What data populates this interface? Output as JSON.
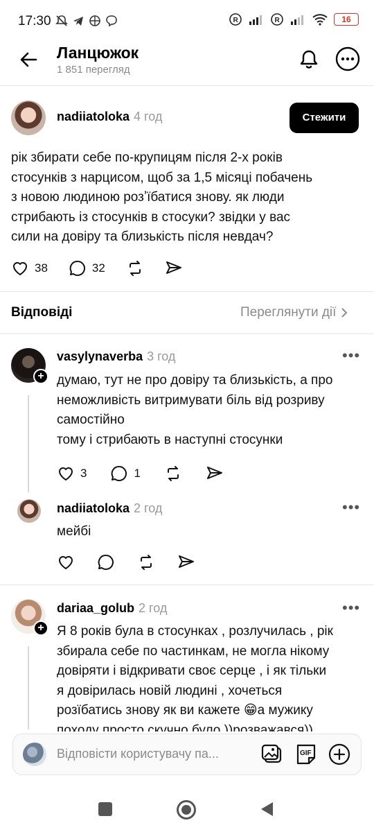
{
  "status_bar": {
    "time": "17:30",
    "battery": "16"
  },
  "header": {
    "title": "Ланцюжок",
    "views": "1 851 перегляд"
  },
  "post": {
    "username": "nadiiatoloka",
    "time": "4 год",
    "follow_label": "Стежити",
    "text_lines": [
      "рік збирати себе по-крупицям після 2-х років",
      "стосунків з нарцисом, щоб за 1,5 місяці побачень",
      "з новою людиною розʼїбатися знову. як люди",
      "стрибають із стосунків в стосуки? звідки у вас",
      "сили на довіру та близькість після невдач?"
    ],
    "likes": "38",
    "comments": "32"
  },
  "replies_section": {
    "label": "Відповіді",
    "view_activity": "Переглянути дії"
  },
  "replies": [
    {
      "username": "vasylynaverba",
      "time": "3 год",
      "text_lines": [
        "думаю, тут не про довіру та близькість, а про",
        "неможливість витримувати біль від розриву",
        "самостійно",
        "тому і стрибають в наступні стосунки"
      ],
      "likes": "3",
      "comments": "1"
    },
    {
      "username": "nadiiatoloka",
      "time": "2 год",
      "text_lines": [
        "мейбі"
      ]
    },
    {
      "username": "dariaa_golub",
      "time": "2 год",
      "text_lines": [
        "Я 8 років була в стосунках , розлучилась , рік",
        "збирала себе по частинкам, не могла нікому",
        "довіряти і відкривати своє серце , і як тільки",
        "я довірилась  новій людині , хочеться",
        "розїбатись знову як ви кажете 😁а мужику",
        "походу просто скучно було ))розважався))"
      ]
    }
  ],
  "reply_bar": {
    "placeholder": "Відповісти користувачу па..."
  }
}
